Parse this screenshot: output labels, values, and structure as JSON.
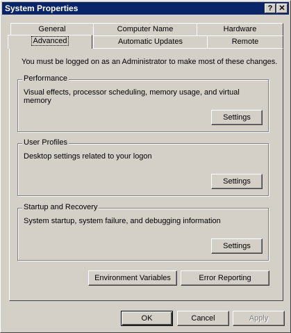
{
  "window": {
    "title": "System Properties",
    "help_label": "?",
    "close_label": "✕"
  },
  "tabs_row1": [
    {
      "label": "General"
    },
    {
      "label": "Computer Name"
    },
    {
      "label": "Hardware"
    }
  ],
  "tabs_row2": [
    {
      "label": "Advanced"
    },
    {
      "label": "Automatic Updates"
    },
    {
      "label": "Remote"
    }
  ],
  "intro": "You must be logged on as an Administrator to make most of these changes.",
  "groups": {
    "performance": {
      "title": "Performance",
      "description": "Visual effects, processor scheduling, memory usage, and virtual memory",
      "button": "Settings"
    },
    "user_profiles": {
      "title": "User Profiles",
      "description": "Desktop settings related to your logon",
      "button": "Settings"
    },
    "startup": {
      "title": "Startup and Recovery",
      "description": "System startup, system failure, and debugging information",
      "button": "Settings"
    }
  },
  "panel_buttons": {
    "env_vars": "Environment Variables",
    "error_reporting": "Error Reporting"
  },
  "dialog_buttons": {
    "ok": "OK",
    "cancel": "Cancel",
    "apply": "Apply"
  }
}
